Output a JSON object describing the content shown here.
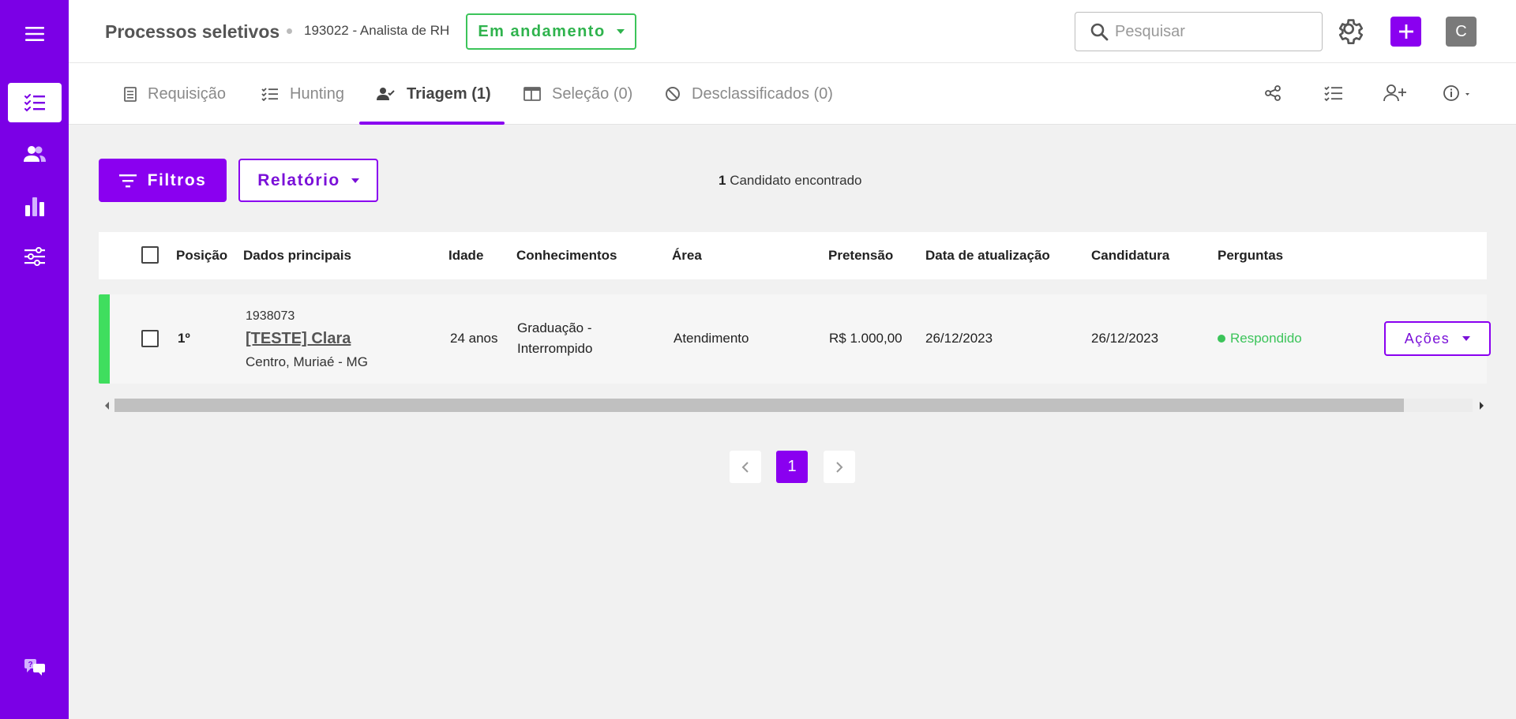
{
  "header": {
    "title": "Processos seletivos",
    "process": "193022 - Analista de RH",
    "status": "Em andamento",
    "search_placeholder": "Pesquisar",
    "avatar_letter": "C"
  },
  "tabs": [
    {
      "label": "Requisição"
    },
    {
      "label": "Hunting"
    },
    {
      "label": "Triagem (1)"
    },
    {
      "label": "Seleção (0)"
    },
    {
      "label": "Desclassificados (0)"
    }
  ],
  "toolbar": {
    "filters_label": "Filtros",
    "report_label": "Relatório",
    "count": "1",
    "count_text": "Candidato encontrado"
  },
  "table": {
    "columns": [
      "Posição",
      "Dados principais",
      "Idade",
      "Conhecimentos",
      "Área",
      "Pretensão",
      "Data de atualização",
      "Candidatura",
      "Perguntas"
    ],
    "rows": [
      {
        "position": "1º",
        "id": "1938073",
        "name": "[TESTE] Clara",
        "location": "Centro, Muriaé - MG",
        "age": "24 anos",
        "knowledge_1": "Graduação -",
        "knowledge_2": "Interrompido",
        "area": "Atendimento",
        "salary": "R$ 1.000,00",
        "updated": "26/12/2023",
        "applied": "26/12/2023",
        "questions": "Respondido",
        "actions_label": "Ações"
      }
    ]
  },
  "pagination": {
    "current": "1"
  },
  "colors": {
    "brand": "#7b00e6",
    "accent": "#8a00f0",
    "success": "#3cc45a"
  }
}
